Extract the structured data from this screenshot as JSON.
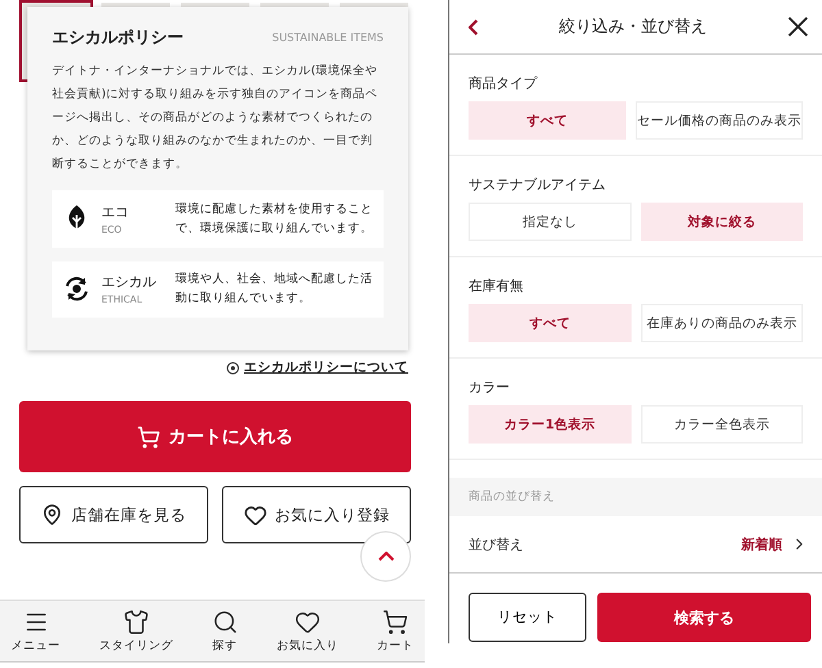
{
  "product_panel": {
    "thumbnails": [
      {
        "selected": true
      },
      {
        "selected": false
      },
      {
        "selected": false
      },
      {
        "selected": false
      },
      {
        "selected": false
      }
    ],
    "popover": {
      "title": "エシカルポリシー",
      "subtitle": "SUSTAINABLE ITEMS",
      "description": "デイトナ・インターナショナルでは、エシカル(環境保全や社会貢献)に対する取り組みを示す独自のアイコンを商品ページへ掲出し、その商品がどのような素材でつくられたのか、どのような取り組みのなかで生まれたのか、一目で判断することができます。",
      "items": [
        {
          "kind": "eco",
          "name": "エコ",
          "name_en": "ECO",
          "text": "環境に配慮した素材を使用することで、環境保護に取り組んでいます。"
        },
        {
          "kind": "ethical",
          "name": "エシカル",
          "name_en": "ETHICAL",
          "text": "環境や人、社会、地域へ配慮した活動に取り組んでいます。"
        }
      ]
    },
    "policy_link": "エシカルポリシーについて",
    "cart_button": "カートに入れる",
    "store_stock_button": "店舗在庫を見る",
    "favorite_button": "お気に入り登録",
    "bottom_nav": [
      {
        "kind": "menu",
        "label": "メニュー"
      },
      {
        "kind": "styling",
        "label": "スタイリング"
      },
      {
        "kind": "search",
        "label": "探す"
      },
      {
        "kind": "favorite",
        "label": "お気に入り"
      },
      {
        "kind": "cart",
        "label": "カート"
      }
    ]
  },
  "filter_panel": {
    "title": "絞り込み・並び替え",
    "groups": [
      {
        "label": "商品タイプ",
        "options": [
          {
            "label": "すべて",
            "selected": true
          },
          {
            "label": "セール価格の商品のみ表示",
            "selected": false
          }
        ]
      },
      {
        "label": "サステナブルアイテム",
        "options": [
          {
            "label": "指定なし",
            "selected": false
          },
          {
            "label": "対象に絞る",
            "selected": true
          }
        ]
      },
      {
        "label": "在庫有無",
        "options": [
          {
            "label": "すべて",
            "selected": true
          },
          {
            "label": "在庫ありの商品のみ表示",
            "selected": false
          }
        ]
      },
      {
        "label": "カラー",
        "options": [
          {
            "label": "カラー1色表示",
            "selected": true
          },
          {
            "label": "カラー全色表示",
            "selected": false
          }
        ]
      }
    ],
    "sort_section": "商品の並び替え",
    "sort": {
      "label": "並び替え",
      "value": "新着順"
    },
    "reset_button": "リセット",
    "search_button": "検索する"
  }
}
